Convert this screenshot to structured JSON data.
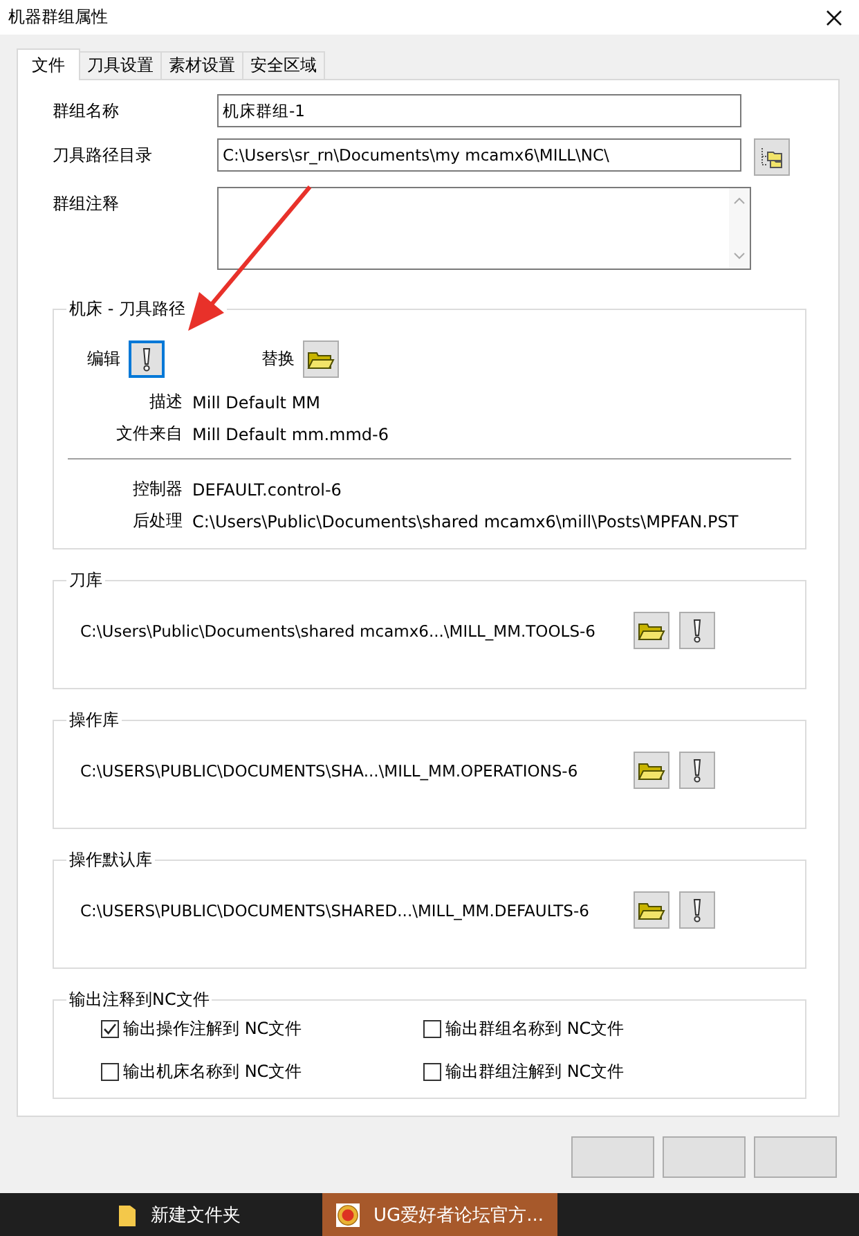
{
  "window": {
    "title": "机器群组属性"
  },
  "tabs": [
    {
      "label": "文件",
      "selected": true
    },
    {
      "label": "刀具设置",
      "selected": false
    },
    {
      "label": "素材设置",
      "selected": false
    },
    {
      "label": "安全区域",
      "selected": false
    }
  ],
  "fields": [
    {
      "kind": "text",
      "label": "群组名称",
      "value": "机床群组-1"
    },
    {
      "kind": "browse",
      "label": "刀具路径目录",
      "value": "C:\\Users\\sr_rn\\Documents\\my mcamx6\\MILL\\NC\\"
    },
    {
      "kind": "textarea",
      "label": "群组注释"
    }
  ],
  "machine_group": {
    "title": "机床 - 刀具路径",
    "edit_label": "编辑",
    "edit_focused": true,
    "replace_label": "替换",
    "info": [
      {
        "label": "描述",
        "value": "Mill Default MM"
      },
      {
        "label": "文件来自",
        "value": "Mill Default mm.mmd-6"
      }
    ],
    "post_info": [
      {
        "label": "控制器",
        "value": "DEFAULT.control-6"
      },
      {
        "label": "后处理",
        "value": "C:\\Users\\Public\\Documents\\shared mcamx6\\mill\\Posts\\MPFAN.PST"
      }
    ]
  },
  "libraries": [
    {
      "title": "刀库",
      "path": "C:\\Users\\Public\\Documents\\shared mcamx6...\\MILL_MM.TOOLS-6"
    },
    {
      "title": "操作库",
      "path": "C:\\USERS\\PUBLIC\\DOCUMENTS\\SHA...\\MILL_MM.OPERATIONS-6"
    },
    {
      "title": "操作默认库",
      "path": "C:\\USERS\\PUBLIC\\DOCUMENTS\\SHARED...\\MILL_MM.DEFAULTS-6"
    }
  ],
  "output": {
    "title": "输出注释到NC文件",
    "options": [
      {
        "label": "输出操作注解到 NC文件",
        "checked": true
      },
      {
        "label": "输出群组名称到 NC文件",
        "checked": false
      },
      {
        "label": "输出机床名称到 NC文件",
        "checked": false
      },
      {
        "label": "输出群组注解到 NC文件",
        "checked": false
      }
    ]
  },
  "taskbar": [
    {
      "kind": "folder",
      "label": "新建文件夹",
      "selected": false
    },
    {
      "kind": "app",
      "label": "UG爱好者论坛官方...",
      "selected": true
    }
  ]
}
